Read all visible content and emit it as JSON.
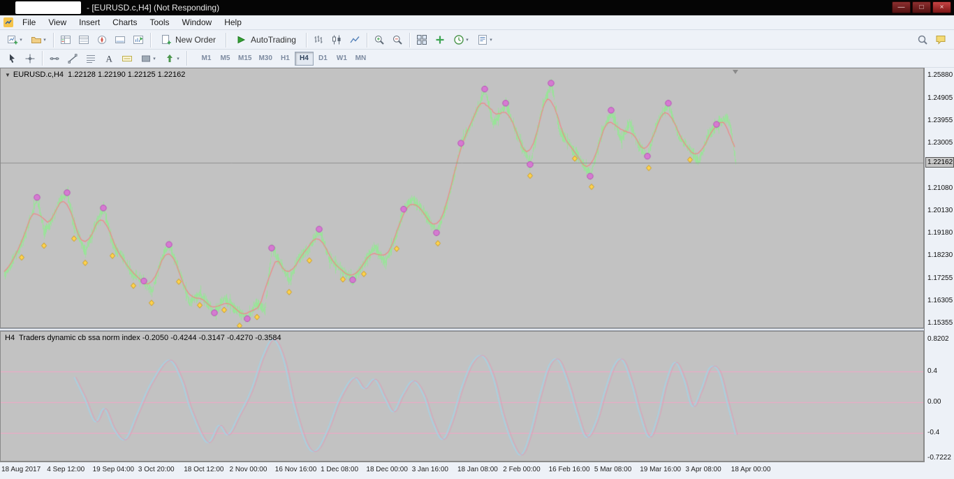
{
  "window": {
    "title": "- [EURUSD.c,H4] (Not Responding)",
    "controls": {
      "minimize": "—",
      "maximize": "□",
      "close": "×"
    }
  },
  "menu": {
    "items": [
      "File",
      "View",
      "Insert",
      "Charts",
      "Tools",
      "Window",
      "Help"
    ]
  },
  "toolbar": {
    "new_order_label": "New Order",
    "autotrading_label": "AutoTrading",
    "standard_icons": [
      "new-chart",
      "profiles",
      "market-watch",
      "data-window",
      "navigator",
      "terminal",
      "strategy-tester",
      "new-order",
      "autotrading",
      "bar-chart",
      "candlestick-chart",
      "line-chart",
      "zoom-in",
      "zoom-out",
      "tile-windows",
      "indicators",
      "periods",
      "templates",
      "search",
      "community"
    ],
    "line_tool_icons": [
      "cursor",
      "crosshair",
      "horizontal-line",
      "trendline",
      "fibonacci",
      "text",
      "text-label",
      "shapes",
      "arrows"
    ]
  },
  "timeframes": {
    "items": [
      "M1",
      "M5",
      "M15",
      "M30",
      "H1",
      "H4",
      "D1",
      "W1",
      "MN"
    ],
    "active": "H4"
  },
  "chart_data": [
    {
      "type": "candlestick",
      "symbol": "EURUSD.c",
      "timeframe": "H4",
      "title": "EURUSD.c,H4  1.22128 1.22190 1.22125 1.22162",
      "ohlc": {
        "open": 1.22128,
        "high": 1.2219,
        "low": 1.22125,
        "close": 1.22162
      },
      "current_price": "1.22162",
      "ylim": [
        1.15355,
        1.2588
      ],
      "y_ticks": [
        "1.25880",
        "1.24905",
        "1.23955",
        "1.23005",
        "1.21080",
        "1.20130",
        "1.19180",
        "1.18230",
        "1.17255",
        "1.16305",
        "1.15355"
      ],
      "x_labels": [
        "18 Aug 2017",
        "4 Sep 12:00",
        "19 Sep 04:00",
        "3 Oct 20:00",
        "18 Oct 12:00",
        "2 Nov 00:00",
        "16 Nov 16:00",
        "1 Dec 08:00",
        "18 Dec 00:00",
        "3 Jan 16:00",
        "18 Jan 08:00",
        "2 Feb 00:00",
        "16 Feb 16:00",
        "5 Mar 08:00",
        "19 Mar 16:00",
        "3 Apr 08:00",
        "18 Apr 00:00"
      ],
      "price_path": [
        [
          5,
          1.174
        ],
        [
          15,
          1.179
        ],
        [
          30,
          1.1875
        ],
        [
          42,
          1.198
        ],
        [
          52,
          1.207
        ],
        [
          62,
          1.192
        ],
        [
          72,
          1.1965
        ],
        [
          85,
          1.206
        ],
        [
          95,
          1.209
        ],
        [
          105,
          1.195
        ],
        [
          121,
          1.1838
        ],
        [
          135,
          1.195
        ],
        [
          147,
          1.2025
        ],
        [
          160,
          1.187
        ],
        [
          175,
          1.181
        ],
        [
          190,
          1.174
        ],
        [
          205,
          1.1715
        ],
        [
          216,
          1.167
        ],
        [
          230,
          1.181
        ],
        [
          241,
          1.187
        ],
        [
          255,
          1.176
        ],
        [
          270,
          1.1625
        ],
        [
          285,
          1.166
        ],
        [
          306,
          1.158
        ],
        [
          320,
          1.164
        ],
        [
          335,
          1.16
        ],
        [
          353,
          1.1555
        ],
        [
          365,
          1.162
        ],
        [
          378,
          1.159
        ],
        [
          388,
          1.1855
        ],
        [
          400,
          1.179
        ],
        [
          413,
          1.1715
        ],
        [
          425,
          1.181
        ],
        [
          440,
          1.185
        ],
        [
          456,
          1.1935
        ],
        [
          470,
          1.181
        ],
        [
          485,
          1.177
        ],
        [
          504,
          1.172
        ],
        [
          520,
          1.179
        ],
        [
          535,
          1.186
        ],
        [
          550,
          1.179
        ],
        [
          565,
          1.19
        ],
        [
          577,
          1.202
        ],
        [
          590,
          1.206
        ],
        [
          605,
          1.201
        ],
        [
          624,
          1.192
        ],
        [
          640,
          1.205
        ],
        [
          659,
          1.23
        ],
        [
          675,
          1.239
        ],
        [
          693,
          1.253
        ],
        [
          705,
          1.238
        ],
        [
          723,
          1.247
        ],
        [
          740,
          1.233
        ],
        [
          758,
          1.221
        ],
        [
          775,
          1.245
        ],
        [
          788,
          1.2555
        ],
        [
          800,
          1.235
        ],
        [
          815,
          1.229
        ],
        [
          830,
          1.223
        ],
        [
          844,
          1.216
        ],
        [
          858,
          1.232
        ],
        [
          874,
          1.244
        ],
        [
          888,
          1.231
        ],
        [
          900,
          1.239
        ],
        [
          913,
          1.229
        ],
        [
          926,
          1.2245
        ],
        [
          940,
          1.239
        ],
        [
          956,
          1.247
        ],
        [
          970,
          1.233
        ],
        [
          985,
          1.228
        ],
        [
          999,
          1.222
        ],
        [
          1012,
          1.233
        ],
        [
          1025,
          1.238
        ],
        [
          1040,
          1.241
        ],
        [
          1046,
          1.235
        ],
        [
          1052,
          1.2216
        ]
      ],
      "circle_markers": [
        [
          52,
          1.207
        ],
        [
          95,
          1.209
        ],
        [
          147,
          1.2025
        ],
        [
          205,
          1.1715
        ],
        [
          241,
          1.187
        ],
        [
          306,
          1.158
        ],
        [
          353,
          1.1555
        ],
        [
          388,
          1.1855
        ],
        [
          456,
          1.1935
        ],
        [
          504,
          1.172
        ],
        [
          577,
          1.202
        ],
        [
          624,
          1.192
        ],
        [
          659,
          1.23
        ],
        [
          693,
          1.253
        ],
        [
          723,
          1.247
        ],
        [
          758,
          1.221
        ],
        [
          788,
          1.2555
        ],
        [
          844,
          1.216
        ],
        [
          874,
          1.244
        ],
        [
          926,
          1.2245
        ],
        [
          956,
          1.247
        ],
        [
          1025,
          1.238
        ]
      ],
      "diamond_markers": [
        [
          30,
          1.1815
        ],
        [
          62,
          1.1865
        ],
        [
          105,
          1.1895
        ],
        [
          121,
          1.1792
        ],
        [
          160,
          1.1822
        ],
        [
          190,
          1.1695
        ],
        [
          216,
          1.1622
        ],
        [
          255,
          1.1712
        ],
        [
          285,
          1.1612
        ],
        [
          320,
          1.1592
        ],
        [
          342,
          1.1525
        ],
        [
          367,
          1.1562
        ],
        [
          413,
          1.1668
        ],
        [
          442,
          1.1802
        ],
        [
          490,
          1.1722
        ],
        [
          520,
          1.1745
        ],
        [
          567,
          1.1852
        ],
        [
          626,
          1.1875
        ],
        [
          758,
          1.2162
        ],
        [
          822,
          1.2235
        ],
        [
          846,
          1.2115
        ],
        [
          928,
          1.2195
        ],
        [
          987,
          1.223
        ]
      ],
      "colors": {
        "background": "#c2c2c2",
        "candles": "#96e696",
        "ma_line": "#ef8585",
        "circles": "#da70d6",
        "diamonds": "#ffd24d",
        "price_line": "#8f8f8f"
      }
    },
    {
      "type": "line",
      "name": "Traders dynamic cb ssa norm index",
      "title": "H4  Traders dynamic cb ssa norm index -0.2050 -0.4244 -0.3147 -0.4270 -0.3584",
      "values_display": [
        "-0.2050",
        "-0.4244",
        "-0.3147",
        "-0.4270",
        "-0.3584"
      ],
      "ylim": [
        -0.7222,
        0.8202
      ],
      "y_ticks": [
        "0.8202",
        "0.4",
        "0.00",
        "-0.4",
        "-0.7222"
      ],
      "levels": [
        0.4,
        0,
        -0.4
      ],
      "path": [
        [
          105,
          0.33
        ],
        [
          120,
          0.05
        ],
        [
          135,
          -0.25
        ],
        [
          148,
          -0.08
        ],
        [
          162,
          -0.35
        ],
        [
          178,
          -0.48
        ],
        [
          195,
          -0.15
        ],
        [
          215,
          0.25
        ],
        [
          240,
          0.55
        ],
        [
          258,
          0.3
        ],
        [
          272,
          -0.1
        ],
        [
          295,
          -0.52
        ],
        [
          312,
          -0.3
        ],
        [
          325,
          -0.42
        ],
        [
          340,
          -0.18
        ],
        [
          358,
          0.15
        ],
        [
          375,
          0.6
        ],
        [
          390,
          0.82
        ],
        [
          405,
          0.55
        ],
        [
          420,
          -0.05
        ],
        [
          438,
          -0.55
        ],
        [
          452,
          -0.62
        ],
        [
          468,
          -0.35
        ],
        [
          485,
          0.05
        ],
        [
          505,
          0.32
        ],
        [
          520,
          0.18
        ],
        [
          535,
          0.3
        ],
        [
          550,
          0.05
        ],
        [
          562,
          -0.12
        ],
        [
          575,
          0.1
        ],
        [
          590,
          0.28
        ],
        [
          605,
          0.1
        ],
        [
          618,
          -0.25
        ],
        [
          632,
          -0.48
        ],
        [
          645,
          -0.25
        ],
        [
          660,
          0.2
        ],
        [
          675,
          0.52
        ],
        [
          690,
          0.6
        ],
        [
          705,
          0.32
        ],
        [
          718,
          -0.15
        ],
        [
          732,
          -0.52
        ],
        [
          745,
          -0.68
        ],
        [
          758,
          -0.4
        ],
        [
          772,
          0.1
        ],
        [
          785,
          0.48
        ],
        [
          798,
          0.55
        ],
        [
          812,
          0.25
        ],
        [
          825,
          -0.15
        ],
        [
          838,
          -0.45
        ],
        [
          852,
          -0.25
        ],
        [
          865,
          0.15
        ],
        [
          878,
          0.48
        ],
        [
          890,
          0.55
        ],
        [
          903,
          0.25
        ],
        [
          915,
          -0.15
        ],
        [
          928,
          -0.45
        ],
        [
          940,
          -0.2
        ],
        [
          952,
          0.25
        ],
        [
          965,
          0.52
        ],
        [
          978,
          0.3
        ],
        [
          990,
          -0.05
        ],
        [
          1002,
          0.15
        ],
        [
          1015,
          0.45
        ],
        [
          1028,
          0.4
        ],
        [
          1040,
          0
        ],
        [
          1052,
          -0.42
        ]
      ],
      "colors": {
        "background": "#c2c2c2",
        "line_primary": "#a9cfe0",
        "line_secondary": "#de9cb8",
        "levels": "#f2a6c6"
      }
    }
  ]
}
